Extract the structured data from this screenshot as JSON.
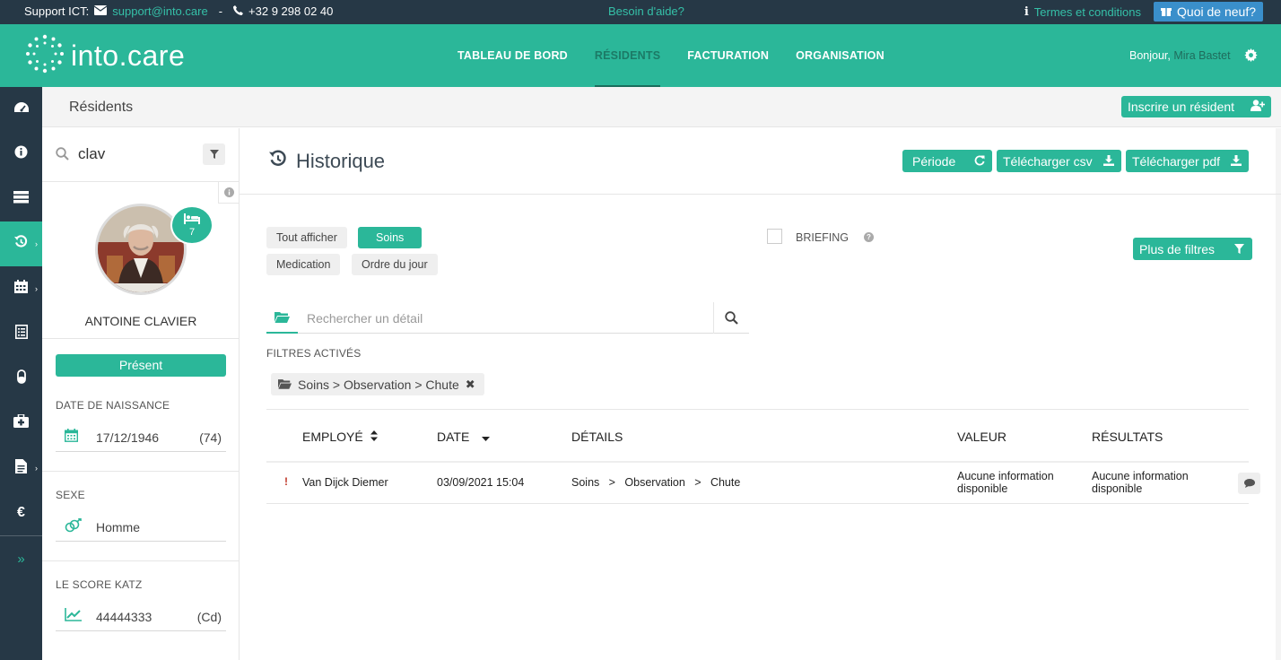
{
  "topbar": {
    "support_label": "Support ICT:",
    "email": "support@into.care",
    "dash": "-",
    "phone": "+32 9 298 02 40",
    "help": "Besoin d'aide?",
    "terms": "Termes et conditions",
    "whats_new": "Quoi de neuf?"
  },
  "header": {
    "logo_text": "into.care",
    "nav": [
      "TABLEAU DE BORD",
      "RÉSIDENTS",
      "FACTURATION",
      "ORGANISATION"
    ],
    "greeting": "Bonjour,",
    "user_name": "Mira Bastet"
  },
  "subheader": {
    "title": "Résidents",
    "enroll_button": "Inscrire un résident"
  },
  "resident": {
    "search_value": "clav",
    "badge_number": "7",
    "name": "ANTOINE CLAVIER",
    "status": "Présent",
    "birth_label": "DATE DE NAISSANCE",
    "birth_date": "17/12/1946",
    "age": "(74)",
    "sex_label": "SEXE",
    "sex": "Homme",
    "katz_label": "LE SCORE KATZ",
    "katz_score": "44444333",
    "katz_class": "(Cd)"
  },
  "history": {
    "title": "Historique",
    "period_button": "Période",
    "csv_button": "Télécharger csv",
    "pdf_button": "Télécharger pdf",
    "chips": {
      "show_all": "Tout afficher",
      "care": "Soins",
      "medication": "Medication",
      "agenda": "Ordre du jour"
    },
    "briefing": "BRIEFING",
    "more_filters": "Plus de filtres",
    "search_placeholder": "Rechercher un détail",
    "active_filters_label": "FILTRES ACTIVÉS",
    "active_filter": "Soins > Observation > Chute",
    "columns": {
      "employee": "EMPLOYÉ",
      "date": "DATE",
      "details": "DÉTAILS",
      "value": "VALEUR",
      "results": "RÉSULTATS"
    },
    "rows": [
      {
        "flag": "!",
        "employee": "Van Dijck Diemer",
        "date": "03/09/2021 15:04",
        "details": "Soins   >   Observation   >   Chute",
        "value_line1": "Aucune information",
        "value_line2": "disponible",
        "results_line1": "Aucune information",
        "results_line2": "disponible"
      }
    ]
  },
  "colors": {
    "brand": "#2bb799",
    "dark": "#263846",
    "link": "#35c0a8",
    "whats_new": "#3a8fcb"
  },
  "icons": [
    "envelope-icon",
    "phone-icon",
    "info-icon",
    "gift-icon",
    "gear-icon",
    "dashboard-icon",
    "history-icon",
    "calendar-icon",
    "search-icon",
    "filter-icon",
    "bed-icon",
    "gender-icon",
    "chart-icon",
    "folder-icon",
    "refresh-icon",
    "download-icon",
    "comment-icon",
    "add-user-icon",
    "euro-icon",
    "expand-icon"
  ]
}
